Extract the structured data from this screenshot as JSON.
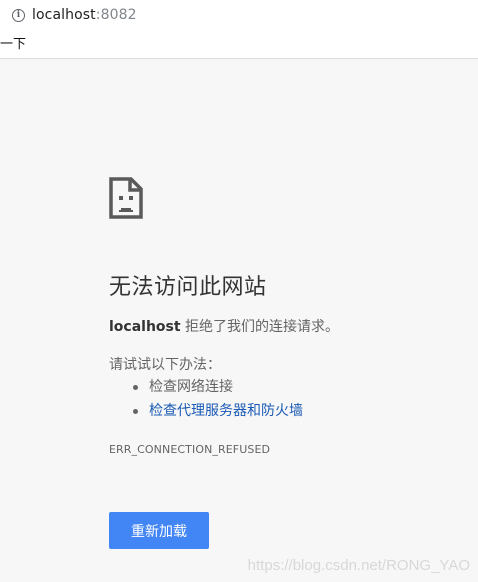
{
  "address_bar": {
    "info_icon": "info-icon",
    "url_host": "localhost",
    "url_port": ":8082"
  },
  "bookmarks_bar": {
    "item_label": "一下"
  },
  "error": {
    "icon": "sad-document-icon",
    "title": "无法访问此网站",
    "host": "localhost",
    "message": " 拒绝了我们的连接请求。",
    "try_heading": "请试试以下办法：",
    "suggestions": [
      {
        "label": "检查网络连接",
        "link": false
      },
      {
        "label": "检查代理服务器和防火墙",
        "link": true
      }
    ],
    "code": "ERR_CONNECTION_REFUSED",
    "reload_label": "重新加载"
  },
  "watermark": "https://blog.csdn.net/RONG_YAO",
  "colors": {
    "reload_button": "#4285f4",
    "link": "#1a5ab5",
    "background": "#f7f7f7"
  }
}
